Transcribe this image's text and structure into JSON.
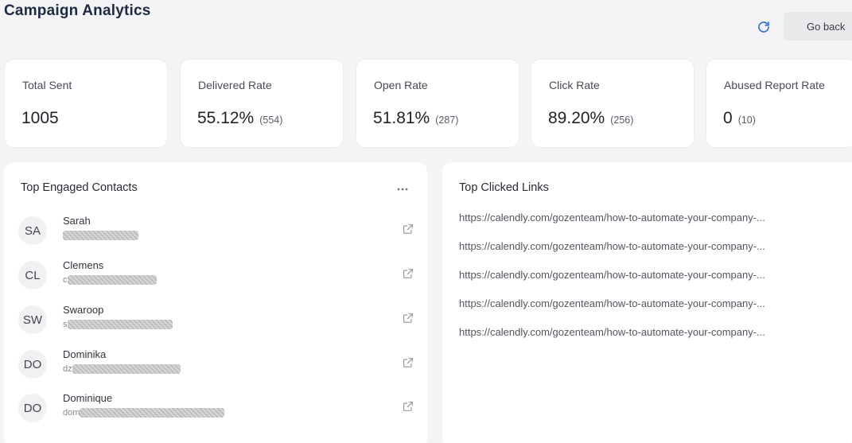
{
  "header": {
    "title": "Campaign Analytics",
    "refresh_icon": "refresh-icon",
    "go_back_label": "Go back"
  },
  "stats": [
    {
      "label": "Total Sent",
      "value": "1005",
      "sub": ""
    },
    {
      "label": "Delivered Rate",
      "value": "55.12%",
      "sub": "(554)"
    },
    {
      "label": "Open Rate",
      "value": "51.81%",
      "sub": "(287)"
    },
    {
      "label": "Click Rate",
      "value": "89.20%",
      "sub": "(256)"
    },
    {
      "label": "Abused Report Rate",
      "value": "0",
      "sub": "(10)"
    }
  ],
  "contacts_panel": {
    "title": "Top Engaged Contacts",
    "more_icon": "more-horizontal-icon",
    "contacts": [
      {
        "initials": "SA",
        "name": "Sarah",
        "email_prefix": ""
      },
      {
        "initials": "CL",
        "name": "Clemens",
        "email_prefix": "c"
      },
      {
        "initials": "SW",
        "name": "Swaroop",
        "email_prefix": "s"
      },
      {
        "initials": "DO",
        "name": "Dominika",
        "email_prefix": "dz"
      },
      {
        "initials": "DO",
        "name": "Dominique",
        "email_prefix": "dom"
      }
    ]
  },
  "links_panel": {
    "title": "Top Clicked Links",
    "links": [
      "https://calendly.com/gozenteam/how-to-automate-your-company-...",
      "https://calendly.com/gozenteam/how-to-automate-your-company-...",
      "https://calendly.com/gozenteam/how-to-automate-your-company-...",
      "https://calendly.com/gozenteam/how-to-automate-your-company-...",
      "https://calendly.com/gozenteam/how-to-automate-your-company-..."
    ]
  },
  "colors": {
    "page_bg": "#f4f4f6",
    "card_bg": "#ffffff",
    "refresh_icon": "#2f6fd6",
    "title": "#1f2a44"
  }
}
